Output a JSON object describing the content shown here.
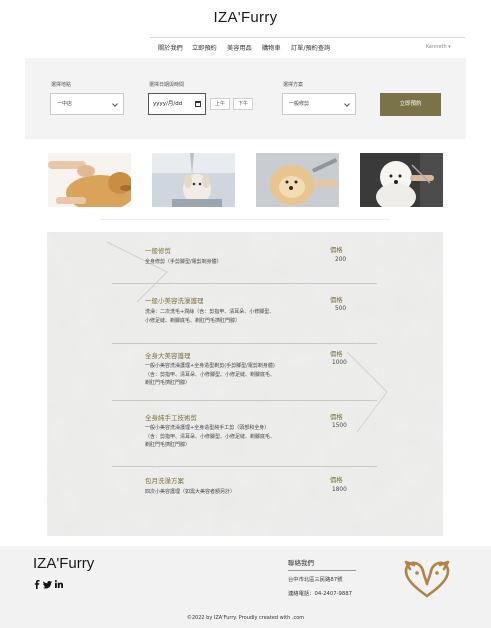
{
  "header": {
    "brand": "IZA'Furry",
    "nav": [
      "關於我們",
      "立即預約",
      "美容用品",
      "購物車",
      "訂單/預約查詢"
    ],
    "user": "Kenneth ▾"
  },
  "booking": {
    "location_label": "選擇地點",
    "location_value": "一中店",
    "date_label": "選擇日期與時間",
    "date_placeholder": "yyyy/月/dd",
    "am_label": "上午",
    "pm_label": "下午",
    "plan_label": "選擇方案",
    "plan_value": "一般修剪",
    "submit_label": "立即預約"
  },
  "services": [
    {
      "title": "一般修剪",
      "desc": "全身修剪（手剪腳型/電剪剃身體）",
      "price_label": "價格",
      "price": "200"
    },
    {
      "title": "一般小美容洗澡護理",
      "desc": "洗澡：二次洗毛+潤絲（含：剪指甲、清耳朵、小修腳型、小修足縫、剃腳底毛、剃肛門毛擠肛門腺）",
      "price_label": "價格",
      "price": "500"
    },
    {
      "title": "全身大美容護理",
      "desc": "一般小美容洗澡護理+全身造型剃剪(手剪腳型/電剪剃身體)（含：剪指甲、清耳朵、小修腳型、小修足縫、剃腳底毛、剃肛門毛擠肛門腺）",
      "price_label": "價格",
      "price": "1000"
    },
    {
      "title": "全身純手工技術剪",
      "desc": "一般小美容洗澡護理+全身造型純手工剪（頭部和全身）（含：剪指甲、清耳朵、小修腳型、小修足縫、剃腳底毛、剃肛門毛擠肛門腺）",
      "price_label": "價格",
      "price": "1500"
    },
    {
      "title": "包月洗澡方案",
      "desc": "四次小美容護理（如需大美容者額另計）",
      "price_label": "價格",
      "price": "1800"
    }
  ],
  "footer": {
    "brand": "IZA'Furry",
    "social": [
      "facebook-icon",
      "twitter-icon",
      "linkedin-icon"
    ],
    "contact_title": "聯絡我們",
    "address": "台中市北區三民路87號",
    "phone": "連絡電話：04-2407-9887",
    "copyright": "©2022 by IZA'Furry. Proudly created with .com"
  },
  "colors": {
    "accent": "#7a7348",
    "title_accent": "#7a6f3c",
    "logo": "#b08447",
    "panel_bg": "#f3f3f3",
    "footer_bg": "#f2f2f2"
  }
}
